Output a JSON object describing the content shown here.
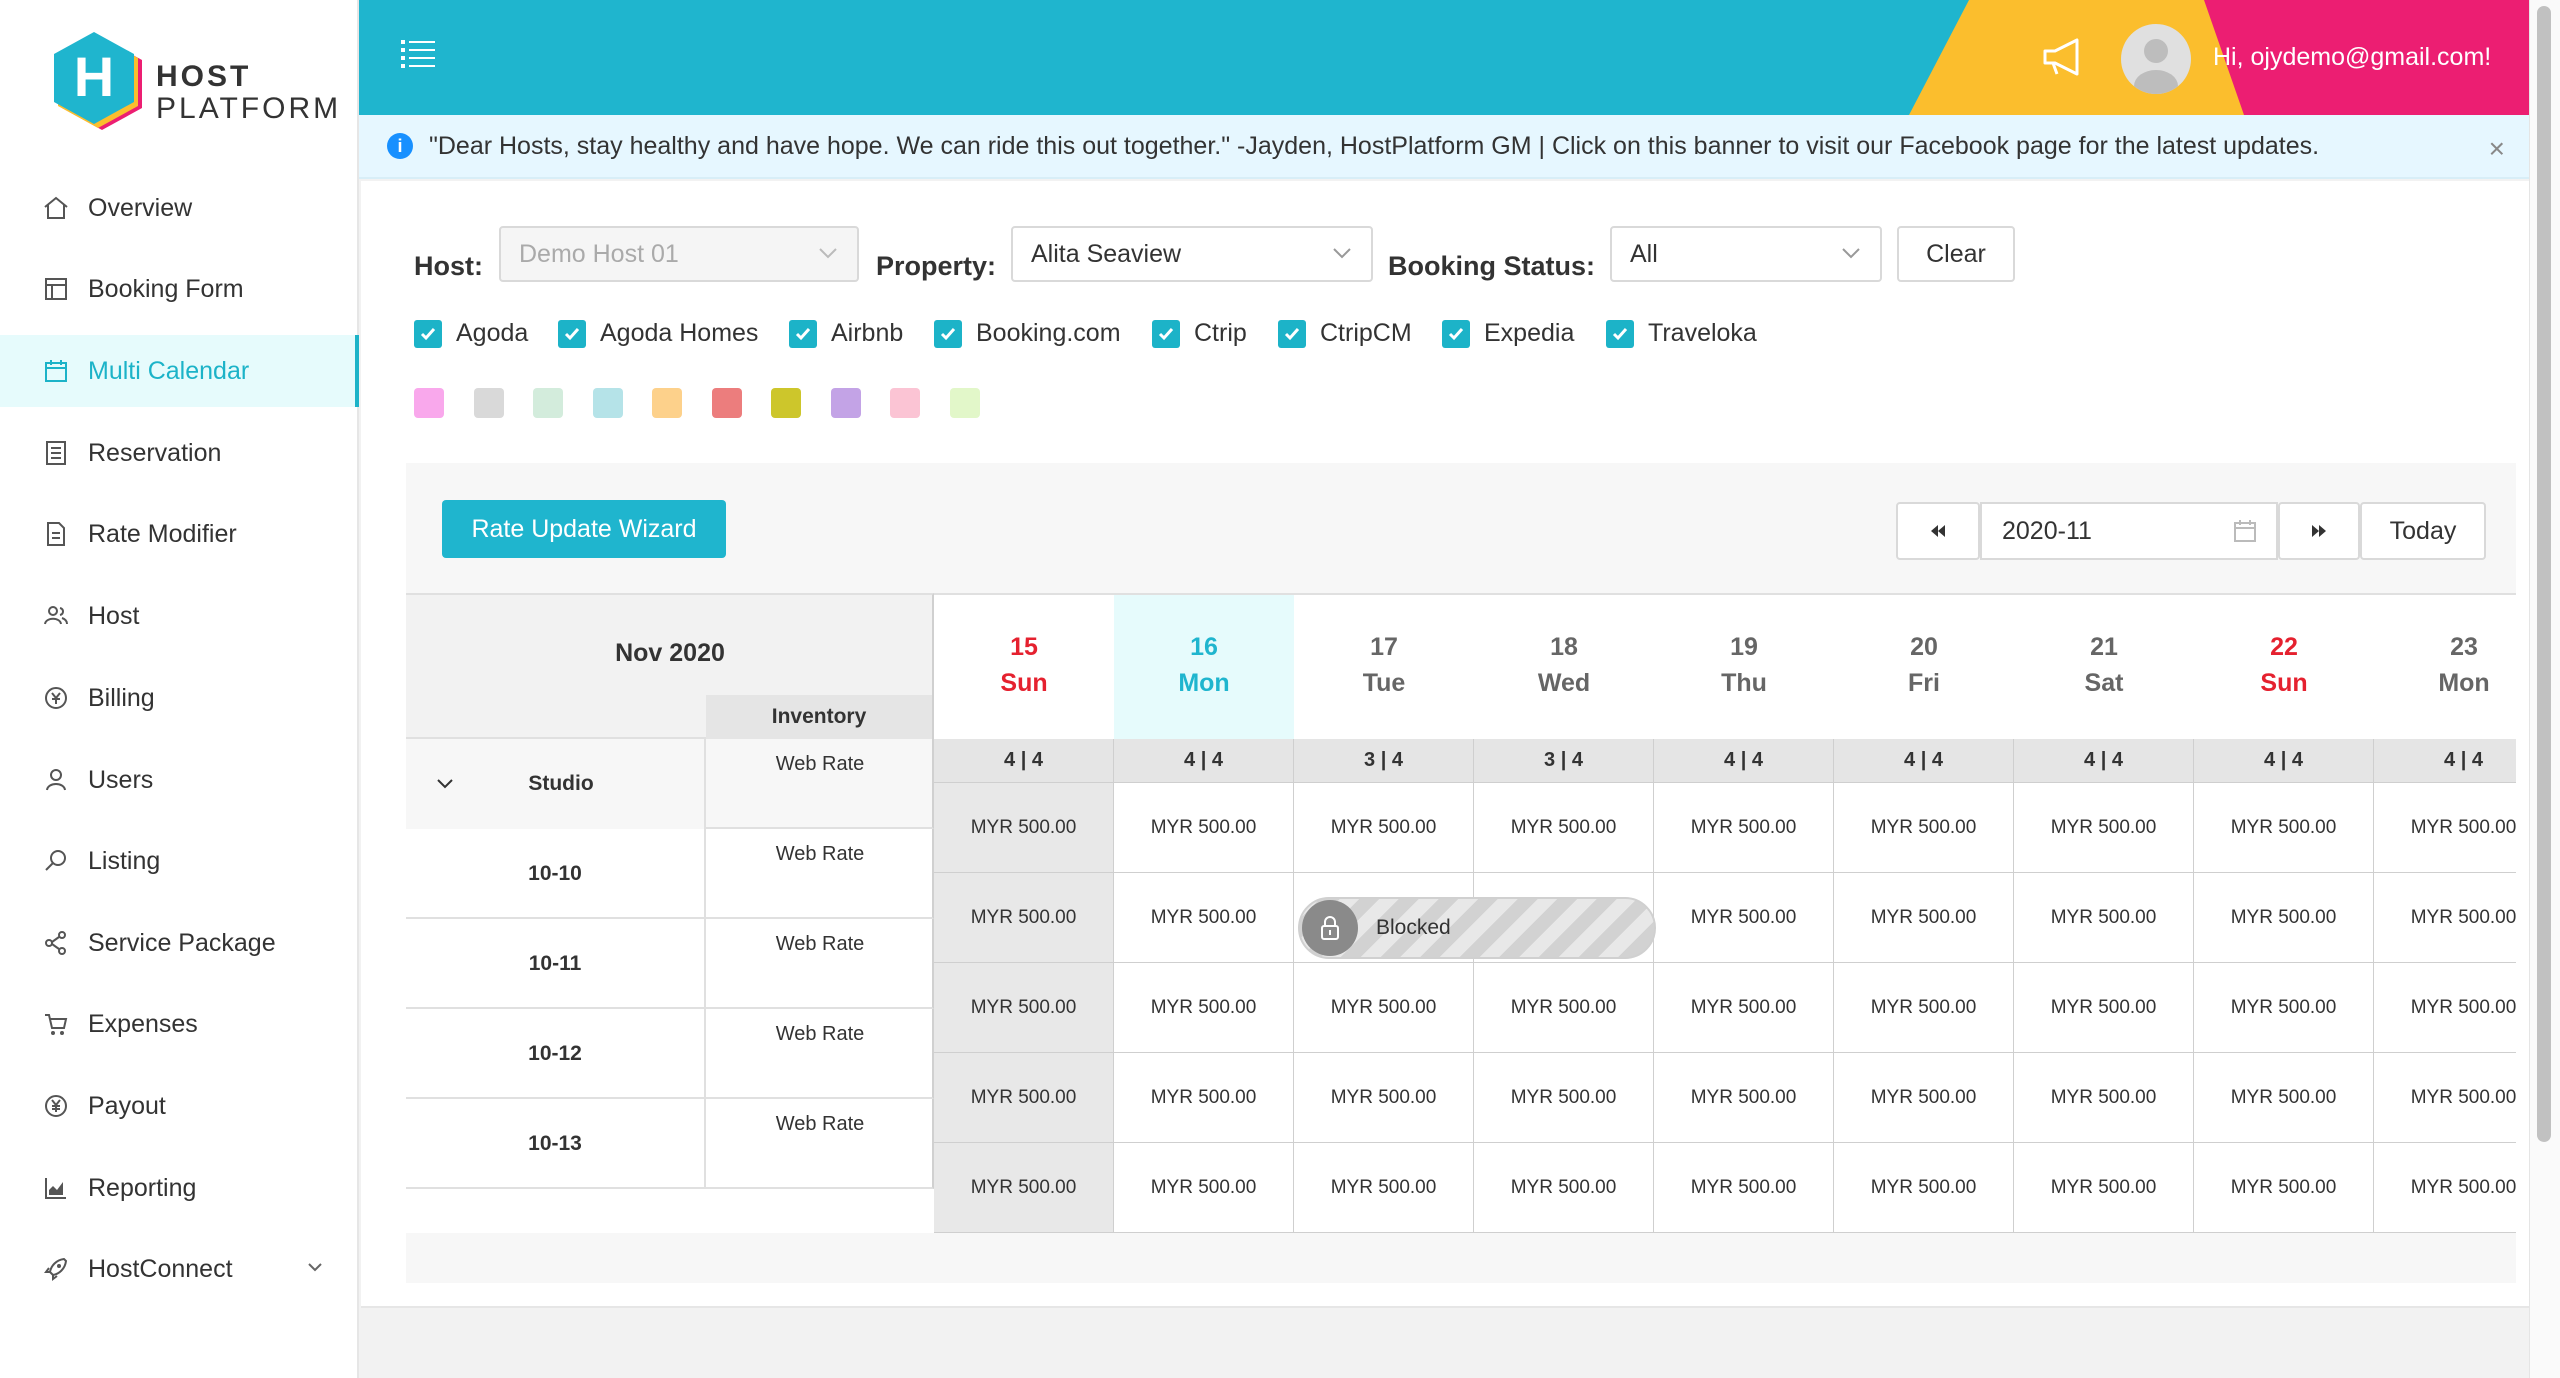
{
  "brand": {
    "line1": "HOST",
    "line2": "PLATFORM",
    "logo_letter": "H"
  },
  "sidebar": {
    "items": [
      {
        "label": "Overview",
        "icon": "home-icon"
      },
      {
        "label": "Booking Form",
        "icon": "form-icon"
      },
      {
        "label": "Multi Calendar",
        "icon": "calendar-icon",
        "active": true
      },
      {
        "label": "Reservation",
        "icon": "list-icon"
      },
      {
        "label": "Rate Modifier",
        "icon": "file-icon"
      },
      {
        "label": "Host",
        "icon": "people-icon"
      },
      {
        "label": "Billing",
        "icon": "currency-icon"
      },
      {
        "label": "Users",
        "icon": "user-icon"
      },
      {
        "label": "Listing",
        "icon": "search-icon"
      },
      {
        "label": "Service Package",
        "icon": "share-icon"
      },
      {
        "label": "Expenses",
        "icon": "cart-icon"
      },
      {
        "label": "Payout",
        "icon": "yen-icon"
      },
      {
        "label": "Reporting",
        "icon": "chart-icon"
      },
      {
        "label": "HostConnect",
        "icon": "rocket-icon"
      }
    ]
  },
  "header": {
    "greeting": "Hi, ojydemo@gmail.com!"
  },
  "banner": {
    "text": "\"Dear Hosts, stay healthy and have hope. We can ride this out together.\" -Jayden, HostPlatform GM | Click on this banner to visit our Facebook page for the latest updates.",
    "close": "×"
  },
  "filters": {
    "host_label": "Host:",
    "host_value": "Demo Host 01",
    "property_label": "Property:",
    "property_value": "Alita Seaview",
    "status_label": "Booking Status:",
    "status_value": "All",
    "clear_label": "Clear"
  },
  "channels": [
    "Agoda",
    "Agoda Homes",
    "Airbnb",
    "Booking.com",
    "Ctrip",
    "CtripCM",
    "Expedia",
    "Traveloka"
  ],
  "swatches": [
    "#f9a8ec",
    "#d9d9d9",
    "#d3ecdc",
    "#b5e3e8",
    "#fdd18b",
    "#ec7d7d",
    "#cdc62b",
    "#c3a3e6",
    "#fbc4d4",
    "#e2f7c9"
  ],
  "calendar": {
    "wizard_label": "Rate Update Wizard",
    "month_value": "2020-11",
    "today_label": "Today",
    "month_title": "Nov 2020",
    "inventory_label": "Inventory",
    "days": [
      {
        "num": "15",
        "name": "Sun",
        "inv": "4 | 4",
        "weekend": true,
        "past": true
      },
      {
        "num": "16",
        "name": "Mon",
        "inv": "4 | 4",
        "today": true
      },
      {
        "num": "17",
        "name": "Tue",
        "inv": "3 | 4"
      },
      {
        "num": "18",
        "name": "Wed",
        "inv": "3 | 4"
      },
      {
        "num": "19",
        "name": "Thu",
        "inv": "4 | 4"
      },
      {
        "num": "20",
        "name": "Fri",
        "inv": "4 | 4"
      },
      {
        "num": "21",
        "name": "Sat",
        "inv": "4 | 4"
      },
      {
        "num": "22",
        "name": "Sun",
        "inv": "4 | 4",
        "weekend": true
      },
      {
        "num": "23",
        "name": "Mon",
        "inv": "4 | 4"
      }
    ],
    "rows": [
      {
        "unit": "Studio",
        "rate_label": "Web Rate",
        "group": true
      },
      {
        "unit": "10-10",
        "rate_label": "Web Rate"
      },
      {
        "unit": "10-11",
        "rate_label": "Web Rate"
      },
      {
        "unit": "10-12",
        "rate_label": "Web Rate"
      },
      {
        "unit": "10-13",
        "rate_label": "Web Rate"
      }
    ],
    "rate_value": "MYR 500.00",
    "blocked_label": "Blocked"
  }
}
